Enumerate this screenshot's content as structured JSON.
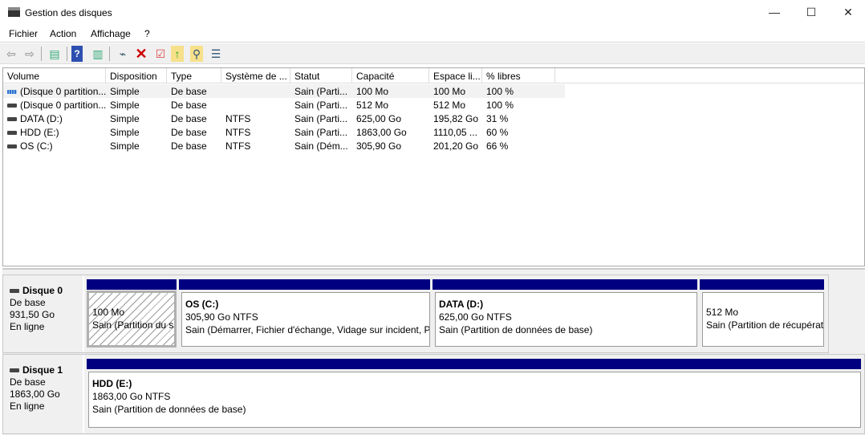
{
  "window": {
    "title": "Gestion des disques",
    "minimize": "—",
    "maximize": "☐",
    "close": "✕"
  },
  "menu": [
    "Fichier",
    "Action",
    "Affichage",
    "?"
  ],
  "toolbar": [
    "back-icon",
    "forward-icon",
    "console-tree-icon",
    "help-icon",
    "action-pane-icon",
    "connect-disk-icon",
    "delete-icon",
    "properties-icon",
    "folder-up-icon",
    "folder-search-icon",
    "checklist-icon"
  ],
  "columns": [
    "Volume",
    "Disposition",
    "Type",
    "Système de ...",
    "Statut",
    "Capacité",
    "Espace li...",
    "% libres"
  ],
  "rows": [
    [
      "(Disque 0 partition...",
      "Simple",
      "De base",
      "",
      "Sain (Parti...",
      "100 Mo",
      "100 Mo",
      "100 %"
    ],
    [
      "(Disque 0 partition...",
      "Simple",
      "De base",
      "",
      "Sain (Parti...",
      "512 Mo",
      "512 Mo",
      "100 %"
    ],
    [
      "DATA (D:)",
      "Simple",
      "De base",
      "NTFS",
      "Sain (Parti...",
      "625,00 Go",
      "195,82 Go",
      "31 %"
    ],
    [
      "HDD (E:)",
      "Simple",
      "De base",
      "NTFS",
      "Sain (Parti...",
      "1863,00 Go",
      "1110,05 ...",
      "60 %"
    ],
    [
      "OS (C:)",
      "Simple",
      "De base",
      "NTFS",
      "Sain (Dém...",
      "305,90 Go",
      "201,20 Go",
      "66 %"
    ]
  ],
  "disks": [
    {
      "name": "Disque 0",
      "type": "De base",
      "size": "931,50 Go",
      "status": "En ligne",
      "partitions": [
        {
          "title": "",
          "size": "100 Mo",
          "status": "Sain (Partition du s"
        },
        {
          "title": "OS  (C:)",
          "size": "305,90 Go NTFS",
          "status": "Sain (Démarrer, Fichier d'échange, Vidage sur incident, Pa"
        },
        {
          "title": "DATA  (D:)",
          "size": "625,00 Go NTFS",
          "status": "Sain (Partition de données de base)"
        },
        {
          "title": "",
          "size": "512 Mo",
          "status": "Sain (Partition de récupérat"
        }
      ]
    },
    {
      "name": "Disque 1",
      "type": "De base",
      "size": "1863,00 Go",
      "status": "En ligne",
      "partitions": [
        {
          "title": "HDD  (E:)",
          "size": "1863,00 Go NTFS",
          "status": "Sain (Partition de données de base)"
        }
      ]
    }
  ],
  "colors": {
    "bar": "#000080"
  }
}
